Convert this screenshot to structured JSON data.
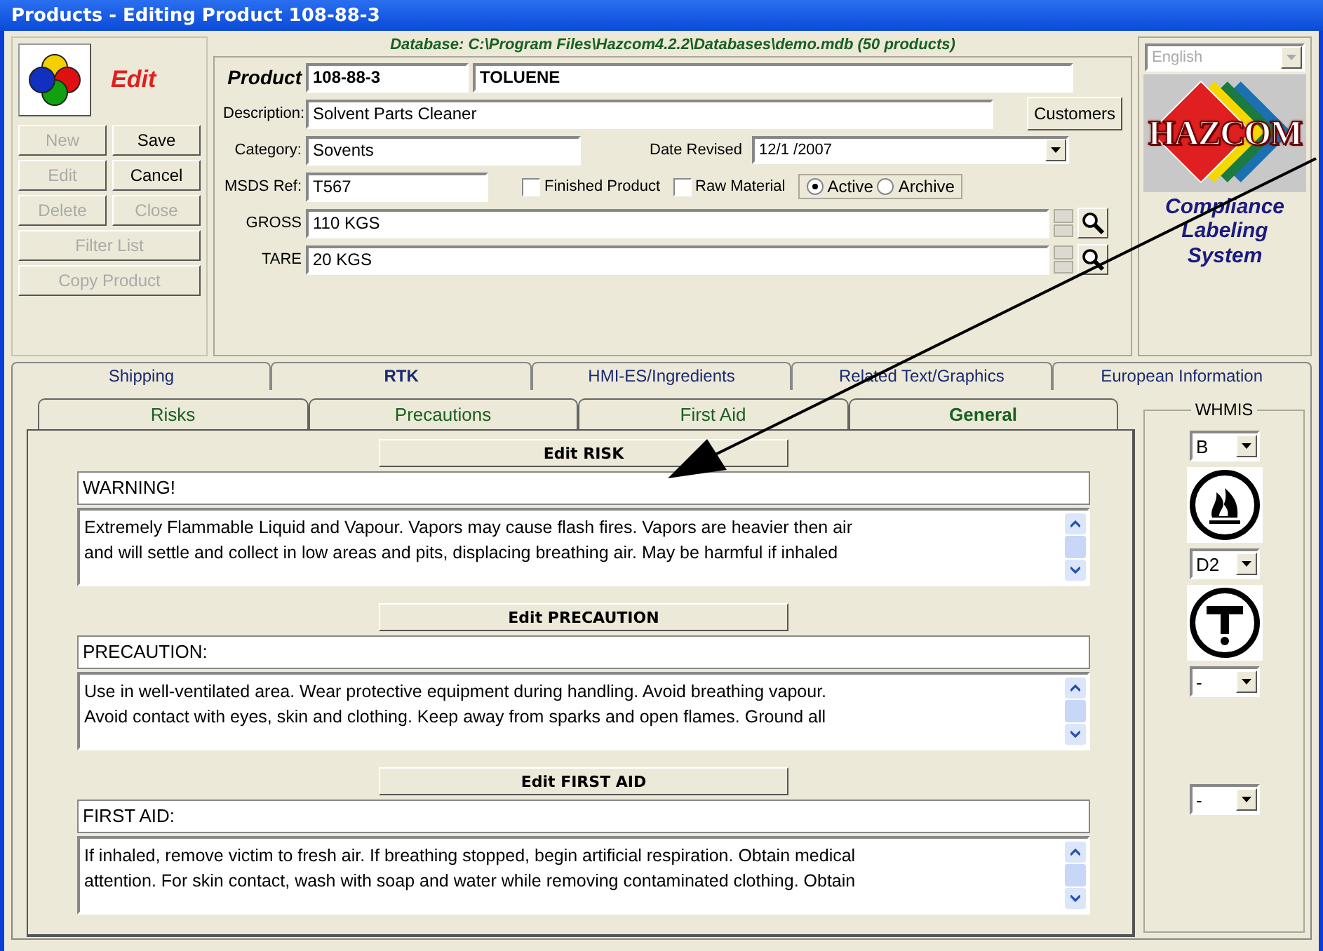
{
  "window": {
    "title": "Products - Editing Product 108-88-3"
  },
  "database_path": "Database: C:\\Program Files\\Hazcom4.2.2\\Databases\\demo.mdb (50 products)",
  "mode_label": "Edit",
  "left_buttons": [
    {
      "label": "New",
      "disabled": true
    },
    {
      "label": "Save",
      "disabled": false
    },
    {
      "label": "Edit",
      "disabled": true
    },
    {
      "label": "Cancel",
      "disabled": false
    },
    {
      "label": "Delete",
      "disabled": true
    },
    {
      "label": "Close",
      "disabled": true
    },
    {
      "label": "Filter List",
      "disabled": true,
      "wide": true
    },
    {
      "label": "Copy Product",
      "disabled": true,
      "wide": true
    }
  ],
  "product": {
    "label": "Product",
    "code": "108-88-3",
    "name": "TOLUENE"
  },
  "description": {
    "label": "Description:",
    "value": "Solvent Parts Cleaner",
    "button": "Customers"
  },
  "category": {
    "label": "Category:",
    "value": "Sovents"
  },
  "date_revised": {
    "label": "Date Revised",
    "value": "12/1 /2007"
  },
  "msds_ref": {
    "label": "MSDS Ref:",
    "value": "T567"
  },
  "checkboxes": [
    {
      "label": "Finished Product",
      "checked": false
    },
    {
      "label": "Raw Material",
      "checked": false
    }
  ],
  "status_radios": [
    {
      "label": "Active",
      "selected": true
    },
    {
      "label": "Archive",
      "selected": false
    }
  ],
  "weights": [
    {
      "label": "GROSS",
      "value": "110 KGS"
    },
    {
      "label": "TARE",
      "value": "20 KGS"
    }
  ],
  "language": {
    "value": "English",
    "disabled": true
  },
  "logo": {
    "text": "HAZCOM",
    "tagline": "Compliance Labeling System"
  },
  "tabs": [
    {
      "label": "Shipping",
      "selected": false
    },
    {
      "label": "RTK",
      "selected": true
    },
    {
      "label": "HMI-ES/Ingredients",
      "selected": false
    },
    {
      "label": "Related Text/Graphics",
      "selected": false
    },
    {
      "label": "European Information",
      "selected": false
    }
  ],
  "subtabs": [
    {
      "label": "Risks",
      "selected": false
    },
    {
      "label": "Precautions",
      "selected": false
    },
    {
      "label": "First Aid",
      "selected": false
    },
    {
      "label": "General",
      "selected": true
    }
  ],
  "sections": [
    {
      "button": "Edit RISK",
      "heading": "WARNING!",
      "text": "Extremely Flammable Liquid and Vapour. Vapors may cause flash fires. Vapors are heavier then air\nand will settle and collect in low areas and pits, displacing breathing air. May be harmful if inhaled"
    },
    {
      "button": "Edit PRECAUTION",
      "heading": "PRECAUTION:",
      "text": "Use in well-ventilated area. Wear protective equipment during handling. Avoid breathing vapour.\nAvoid contact with eyes, skin and clothing. Keep away from sparks and open flames. Ground all"
    },
    {
      "button": "Edit FIRST AID",
      "heading": "FIRST AID:",
      "text": "If inhaled, remove victim to fresh air. If breathing stopped, begin artificial respiration. Obtain medical\nattention. For skin contact, wash with soap and water while removing contaminated clothing. Obtain"
    }
  ],
  "whmis": {
    "label": "WHMIS",
    "classes": [
      {
        "value": "B",
        "kind": "flame"
      },
      {
        "value": "D2",
        "kind": "toxic"
      },
      {
        "value": "-"
      },
      {
        "value": "-"
      }
    ]
  }
}
